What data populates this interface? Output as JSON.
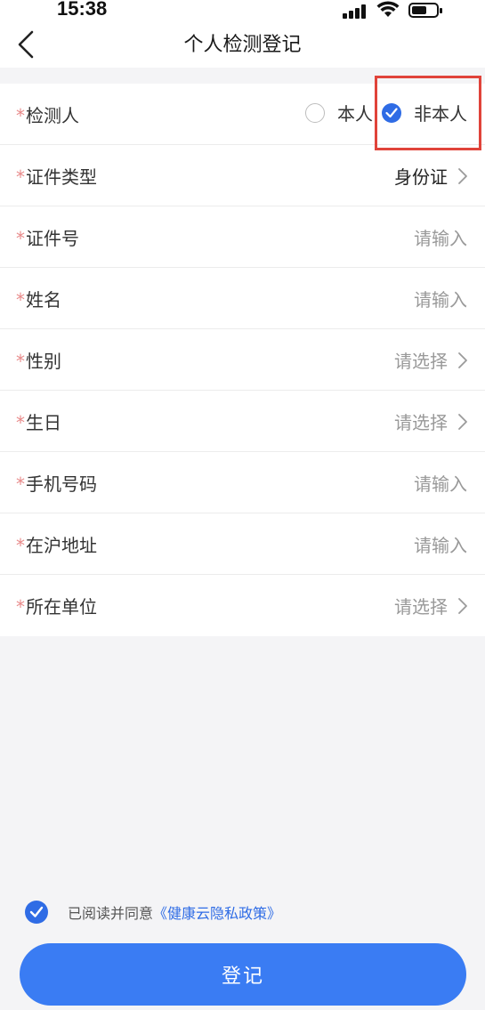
{
  "status_bar": {
    "time": "15:38"
  },
  "header": {
    "title": "个人检测登记"
  },
  "form": {
    "required_mark": "*",
    "tester": {
      "label": "检测人",
      "options": [
        {
          "label": "本人",
          "checked": false
        },
        {
          "label": "非本人",
          "checked": true
        }
      ]
    },
    "rows": [
      {
        "label": "证件类型",
        "value": "身份证",
        "filled": true,
        "chevron": true
      },
      {
        "label": "证件号",
        "value": "请输入",
        "filled": false,
        "chevron": false
      },
      {
        "label": "姓名",
        "value": "请输入",
        "filled": false,
        "chevron": false
      },
      {
        "label": "性别",
        "value": "请选择",
        "filled": false,
        "chevron": true
      },
      {
        "label": "生日",
        "value": "请选择",
        "filled": false,
        "chevron": true
      },
      {
        "label": "手机号码",
        "value": "请输入",
        "filled": false,
        "chevron": false
      },
      {
        "label": "在沪地址",
        "value": "请输入",
        "filled": false,
        "chevron": false
      },
      {
        "label": "所在单位",
        "value": "请选择",
        "filled": false,
        "chevron": true
      }
    ]
  },
  "agreement": {
    "checked": true,
    "text": "已阅读并同意",
    "link": "《健康云隐私政策》"
  },
  "submit": {
    "label": "登记"
  },
  "colors": {
    "accent": "#2f6ce5",
    "button": "#3a7cf3",
    "highlight": "#e0433a",
    "required": "#e88a8a"
  },
  "icons": [
    "back-chevron-icon",
    "chevron-right-icon",
    "check-icon",
    "signal-icon",
    "wifi-icon",
    "battery-icon"
  ]
}
